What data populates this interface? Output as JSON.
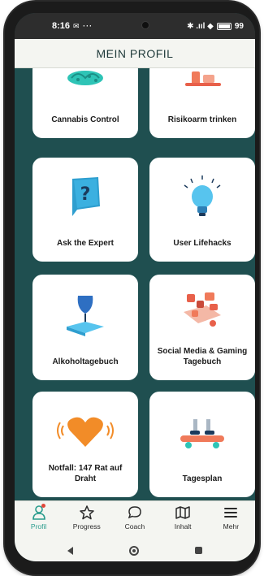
{
  "status_bar": {
    "time": "8:16",
    "left_icons": "✉ ···",
    "right_icons": "✱ .ııl ◆",
    "battery_label": "99"
  },
  "header": {
    "title": "MEIN PROFIL"
  },
  "tiles": [
    {
      "label": "Cannabis Control",
      "icon": "cannabis-leaf-icon"
    },
    {
      "label": "Risikoarm trinken",
      "icon": "drinks-icon"
    },
    {
      "label": "Ask the Expert",
      "icon": "question-card-icon"
    },
    {
      "label": "User Lifehacks",
      "icon": "light-bulb-icon"
    },
    {
      "label": "Alkoholtagebuch",
      "icon": "wine-glass-book-icon"
    },
    {
      "label": "Social Media & Gaming Tagebuch",
      "icon": "social-media-icon"
    },
    {
      "label": "Notfall: 147 Rat auf Draht",
      "icon": "heart-icon"
    },
    {
      "label": "Tagesplan",
      "icon": "skateboard-icon"
    }
  ],
  "bottom_nav": [
    {
      "label": "Profil",
      "icon": "profile-icon",
      "active": true
    },
    {
      "label": "Progress",
      "icon": "star-icon",
      "active": false
    },
    {
      "label": "Coach",
      "icon": "chat-bubble-icon",
      "active": false
    },
    {
      "label": "Inhalt",
      "icon": "map-icon",
      "active": false
    },
    {
      "label": "Mehr",
      "icon": "menu-icon",
      "active": false
    }
  ],
  "colors": {
    "background": "#1f4f50",
    "accent": "#2a9c8d",
    "tile": "#ffffff",
    "header": "#f4f5f1"
  }
}
